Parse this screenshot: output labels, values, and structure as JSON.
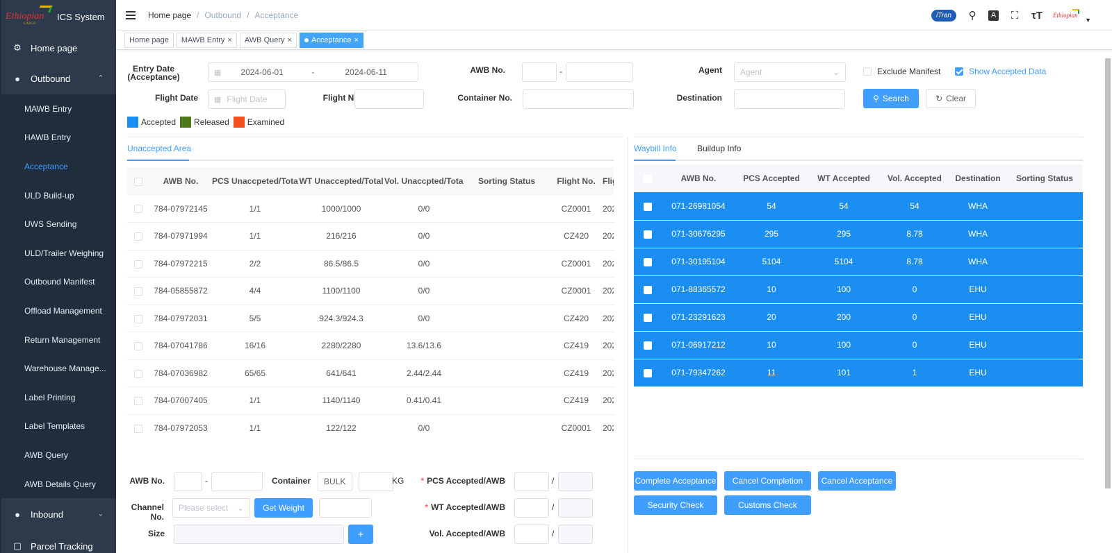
{
  "app": {
    "title": "ICS System",
    "logo_text": "Ethiopian",
    "logo_sub": "CARGO"
  },
  "sidebar": {
    "home": "Home page",
    "outbound": {
      "label": "Outbound",
      "items": [
        {
          "label": "MAWB Entry"
        },
        {
          "label": "HAWB Entry"
        },
        {
          "label": "Acceptance"
        },
        {
          "label": "ULD Build-up"
        },
        {
          "label": "UWS Sending"
        },
        {
          "label": "ULD/Trailer Weighing"
        },
        {
          "label": "Outbound Manifest"
        },
        {
          "label": "Offload Management"
        },
        {
          "label": "Return Management"
        },
        {
          "label": "Warehouse Manage..."
        },
        {
          "label": "Label Printing"
        },
        {
          "label": "Label Templates"
        },
        {
          "label": "AWB Query"
        },
        {
          "label": "AWB Details Query"
        }
      ]
    },
    "inbound": "Inbound",
    "parcel": "Parcel Tracking"
  },
  "header": {
    "breadcrumb": [
      "Home page",
      "/",
      "Outbound",
      "/",
      "Acceptance"
    ],
    "itran": "iTran",
    "avatar_logo": "Ethiopian"
  },
  "tags": [
    {
      "label": "Home page",
      "closable": false
    },
    {
      "label": "MAWB Entry",
      "closable": true
    },
    {
      "label": "AWB Query",
      "closable": true
    },
    {
      "label": "Acceptance",
      "closable": true,
      "active": true
    }
  ],
  "filters": {
    "entry_date_label": "Entry Date (Acceptance)",
    "entry_date_start": "2024-06-01",
    "entry_date_sep": "-",
    "entry_date_end": "2024-06-11",
    "awb_label": "AWB No.",
    "awb_dash": "-",
    "agent_label": "Agent",
    "agent_placeholder": "Agent",
    "exclude_manifest": "Exclude Manifest",
    "show_accepted": "Show Accepted Data",
    "flight_date_label": "Flight Date",
    "flight_date_placeholder": "Flight Date",
    "flight_no_label": "Flight No.",
    "container_label": "Container No.",
    "destination_label": "Destination",
    "search": "Search",
    "clear": "Clear"
  },
  "legend": [
    {
      "label": "Accepted",
      "color": "#1b8ff1"
    },
    {
      "label": "Released",
      "color": "#4c7a1b"
    },
    {
      "label": "Examined",
      "color": "#f4511e"
    }
  ],
  "left": {
    "tab": "Unaccepted Area",
    "columns": [
      "AWB No.",
      "PCS Unaccpeted/Total",
      "WT Unaccepted/Total",
      "Vol. Unaccpted/Total",
      "Sorting Status",
      "Flight No.",
      "Flig"
    ],
    "rows": [
      [
        "784-07972145",
        "1/1",
        "1000/1000",
        "0/0",
        "",
        "CZ0001",
        "202"
      ],
      [
        "784-07971994",
        "1/1",
        "216/216",
        "0/0",
        "",
        "CZ420",
        "202"
      ],
      [
        "784-07972215",
        "2/2",
        "86.5/86.5",
        "0/0",
        "",
        "CZ0001",
        "202"
      ],
      [
        "784-05855872",
        "4/4",
        "1100/1100",
        "0/0",
        "",
        "CZ0001",
        "202"
      ],
      [
        "784-07972031",
        "5/5",
        "924.3/924.3",
        "0/0",
        "",
        "CZ420",
        "202"
      ],
      [
        "784-07041786",
        "16/16",
        "2280/2280",
        "13.6/13.6",
        "",
        "CZ419",
        "202"
      ],
      [
        "784-07036982",
        "65/65",
        "641/641",
        "2.44/2.44",
        "",
        "CZ419",
        "202"
      ],
      [
        "784-07007405",
        "1/1",
        "1140/1140",
        "0.41/0.41",
        "",
        "CZ419",
        "202"
      ],
      [
        "784-07972053",
        "1/1",
        "122/122",
        "0/0",
        "",
        "CZ0001",
        "202"
      ]
    ]
  },
  "right": {
    "tabs": [
      "Waybill Info",
      "Buildup Info"
    ],
    "columns": [
      "AWB No.",
      "PCS Accepted",
      "WT Accepted",
      "Vol. Accepted",
      "Destination",
      "Sorting Status"
    ],
    "rows": [
      [
        "071-26981054",
        "54",
        "54",
        "54",
        "WHA",
        ""
      ],
      [
        "071-30676295",
        "295",
        "295",
        "8.78",
        "WHA",
        ""
      ],
      [
        "071-30195104",
        "5104",
        "5104",
        "8.78",
        "WHA",
        ""
      ],
      [
        "071-88365572",
        "10",
        "100",
        "0",
        "EHU",
        ""
      ],
      [
        "071-23291623",
        "20",
        "200",
        "0",
        "EHU",
        ""
      ],
      [
        "071-06917212",
        "10",
        "100",
        "0",
        "EHU",
        ""
      ],
      [
        "071-79347262",
        "11",
        "101",
        "1",
        "EHU",
        ""
      ]
    ]
  },
  "form": {
    "awb_label": "AWB No.",
    "awb_dash": "-",
    "container_label": "Container",
    "container_value": "BULK",
    "kg_unit": "KG",
    "pcs_label": "PCS Accepted/AWB",
    "wt_label": "WT Accepted/AWB",
    "vol_label": "Vol. Accepted/AWB",
    "slash": "/",
    "channel_label": "Channel No.",
    "channel_placeholder": "Please select",
    "get_weight": "Get Weight",
    "size_label": "Size",
    "plus": "+",
    "req": "*"
  },
  "actions": {
    "complete": "Complete Acceptance",
    "cancel_completion": "Cancel Completion",
    "cancel_acceptance": "Cancel Acceptance",
    "security": "Security Check",
    "customs": "Customs Check"
  }
}
